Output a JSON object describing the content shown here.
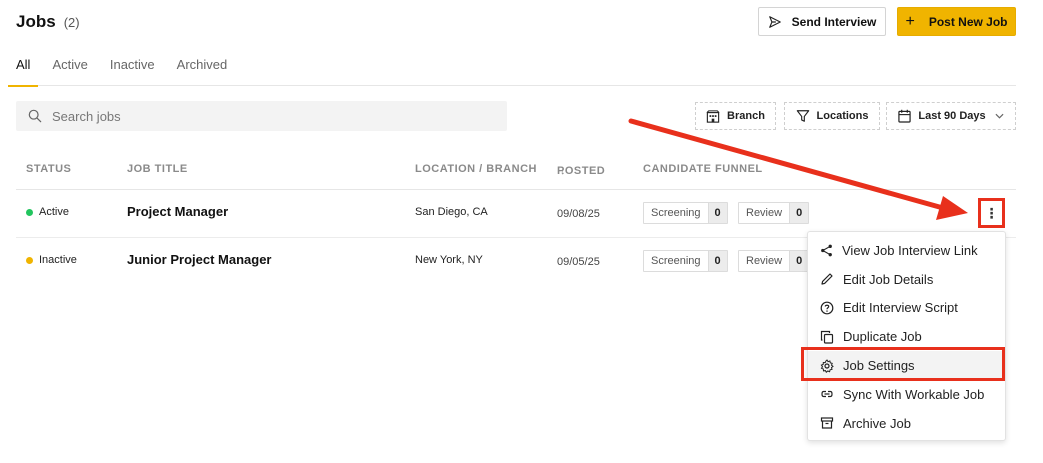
{
  "header": {
    "title": "Jobs",
    "count": "(2)",
    "send_interview_label": "Send Interview",
    "post_job_label": "Post New Job",
    "post_job_plus": "+"
  },
  "tabs": [
    {
      "label": "All",
      "active": true
    },
    {
      "label": "Active",
      "active": false
    },
    {
      "label": "Inactive",
      "active": false
    },
    {
      "label": "Archived",
      "active": false
    }
  ],
  "search": {
    "placeholder": "Search jobs",
    "value": ""
  },
  "filters": {
    "branch": "Branch",
    "locations": "Locations",
    "date_range": "Last 90 Days"
  },
  "table": {
    "columns": [
      "STATUS",
      "JOB TITLE",
      "LOCATION / BRANCH",
      "POSTED",
      "CANDIDATE FUNNEL"
    ],
    "posted_sort_icon": "↓",
    "rows": [
      {
        "status": "Active",
        "status_color": "#22c55e",
        "title": "Project Manager",
        "location": "San Diego, CA",
        "posted": "09/08/25",
        "screening_label": "Screening",
        "screening": "0",
        "review_label": "Review",
        "review": "0"
      },
      {
        "status": "Inactive",
        "status_color": "#f0b400",
        "title": "Junior Project Manager",
        "location": "New York, NY",
        "posted": "09/05/25",
        "screening_label": "Screening",
        "screening": "0",
        "review_label": "Review",
        "review": "0"
      }
    ]
  },
  "kebab_icon": "⋮",
  "menu": {
    "items": [
      {
        "label": "View Job Interview Link",
        "icon": "share-icon"
      },
      {
        "label": "Edit Job Details",
        "icon": "pencil-icon"
      },
      {
        "label": "Edit Interview Script",
        "icon": "question-circle-icon"
      },
      {
        "label": "Duplicate Job",
        "icon": "copy-icon"
      },
      {
        "label": "Job Settings",
        "icon": "gear-icon",
        "highlighted": true
      },
      {
        "label": "Sync With Workable Job",
        "icon": "link-icon"
      },
      {
        "label": "Archive Job",
        "icon": "archive-icon"
      }
    ]
  },
  "colors": {
    "accent": "#f0b400",
    "annotation_red": "#e8301c",
    "active_green": "#22c55e"
  }
}
